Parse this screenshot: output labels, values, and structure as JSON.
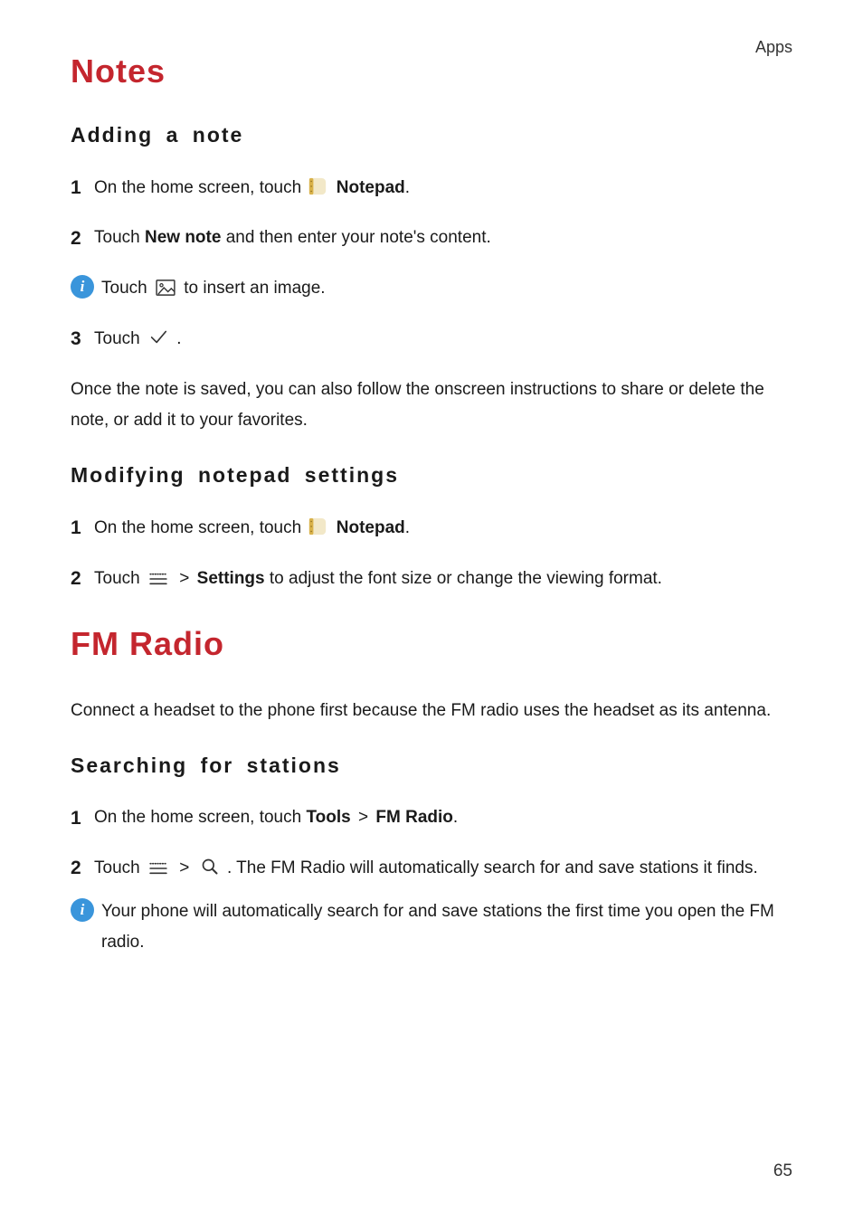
{
  "header": {
    "section": "Apps"
  },
  "page_number": "65",
  "s1": {
    "title": "Notes",
    "h_add": "Adding a note",
    "add_step1_a": "On the home screen, touch ",
    "add_step1_b": "Notepad",
    "add_step1_c": ".",
    "add_step2_a": "Touch ",
    "add_step2_b": "New note",
    "add_step2_c": " and then enter your note's content.",
    "add_info_a": "Touch ",
    "add_info_b": " to insert an image.",
    "add_step3_a": "Touch ",
    "add_step3_b": ".",
    "add_para": "Once the note is saved, you can also follow the onscreen instructions to share or delete the note, or add it to your favorites.",
    "h_mod": "Modifying notepad settings",
    "mod_step1_a": "On the home screen, touch ",
    "mod_step1_b": "Notepad",
    "mod_step1_c": ".",
    "mod_step2_a": "Touch ",
    "mod_step2_gt": ">",
    "mod_step2_b": "Settings",
    "mod_step2_c": " to adjust the font size or change the viewing format."
  },
  "s2": {
    "title": "FM Radio",
    "intro": "Connect a headset to the phone first because the FM radio uses the headset as its antenna.",
    "h_search": "Searching for stations",
    "sr_step1_a": "On the home screen, touch ",
    "sr_step1_b": "Tools",
    "sr_step1_gt": ">",
    "sr_step1_c": "FM Radio",
    "sr_step1_d": ".",
    "sr_step2_a": "Touch ",
    "sr_step2_gt": ">",
    "sr_step2_b": ". The FM Radio will automatically search for and save stations it finds.",
    "sr_info": "Your phone will automatically search for and save stations the first time you open the FM radio."
  },
  "nums": {
    "n1": "1",
    "n2": "2",
    "n3": "3"
  }
}
